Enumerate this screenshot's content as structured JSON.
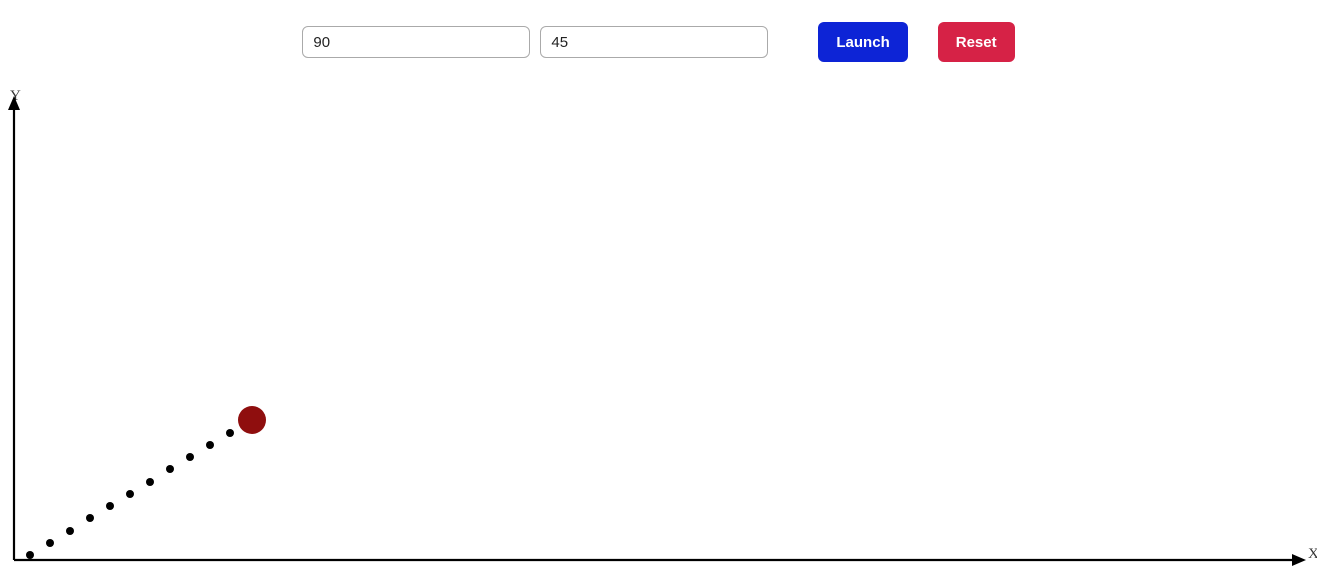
{
  "controls": {
    "input1_value": "90",
    "input2_value": "45",
    "launch_label": "Launch",
    "reset_label": "Reset",
    "launch_color": "#0d24d6",
    "reset_color": "#d62246"
  },
  "axes": {
    "y_label": "Y",
    "x_label": "X"
  },
  "chart_data": {
    "type": "scatter",
    "title": "",
    "xlabel": "X",
    "ylabel": "Y",
    "xlim": [
      0,
      1300
    ],
    "ylim": [
      0,
      460
    ],
    "trace_points": [
      {
        "x": 16,
        "y": 5
      },
      {
        "x": 36,
        "y": 17
      },
      {
        "x": 56,
        "y": 29
      },
      {
        "x": 76,
        "y": 42
      },
      {
        "x": 96,
        "y": 54
      },
      {
        "x": 116,
        "y": 66
      },
      {
        "x": 136,
        "y": 78
      },
      {
        "x": 156,
        "y": 91
      },
      {
        "x": 176,
        "y": 103
      },
      {
        "x": 196,
        "y": 115
      },
      {
        "x": 216,
        "y": 127
      }
    ],
    "ball": {
      "x": 238,
      "y": 140,
      "r": 14,
      "color": "#8f0e0e"
    }
  }
}
